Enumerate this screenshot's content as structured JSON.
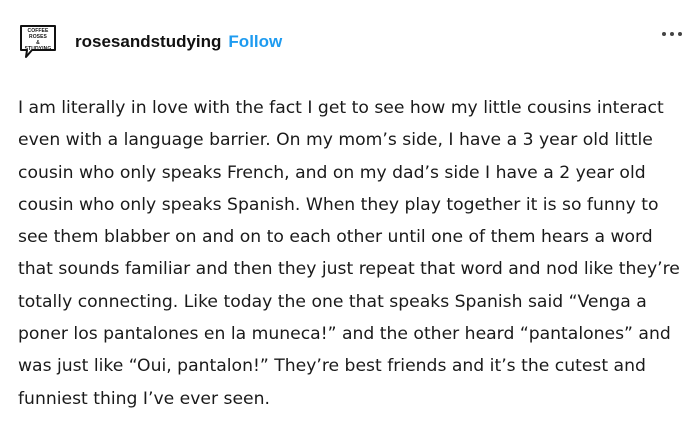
{
  "post": {
    "avatar": {
      "text_lines": [
        "COFFEE",
        "ROSES",
        "&",
        "STUDYING"
      ]
    },
    "username": "rosesandstudying",
    "follow_label": "Follow",
    "more_icon": "ellipsis-icon",
    "accent_color": "#1e9bf0",
    "body": "I am literally in love with the fact I get to see how my little cousins interact even with a language barrier. On my mom’s side, I have a 3 year old little cousin who only speaks French, and on my dad’s side I have a 2 year old cousin who only speaks Spanish. When they play together it is so funny to see them blabber on and on to each other until one of them hears a word that sounds familiar and then they just repeat that word and nod like they’re totally connecting. Like today the one that speaks Spanish said “Venga a poner los pantalones en la muneca!” and the other heard “pantalones” and was just like “Oui, pantalon!” They’re best friends and it’s the cutest and funniest thing I’ve ever seen."
  }
}
